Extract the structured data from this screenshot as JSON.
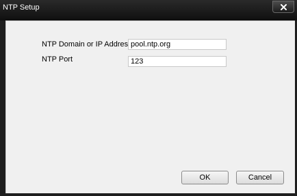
{
  "window": {
    "title": "NTP Setup",
    "close_icon": "close-x-icon"
  },
  "form": {
    "domain_label": "NTP Domain or IP Address",
    "domain_value": "pool.ntp.org",
    "port_label": "NTP Port",
    "port_value": "123"
  },
  "buttons": {
    "ok_label": "OK",
    "cancel_label": "Cancel"
  },
  "colors": {
    "frame": "#1e1e1e",
    "client_background": "#f0f0f0"
  }
}
